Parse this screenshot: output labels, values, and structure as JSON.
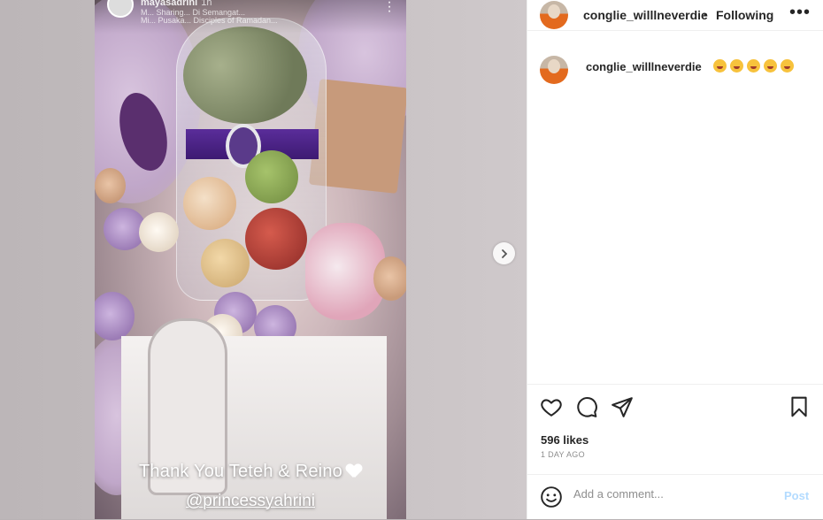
{
  "story": {
    "username": "mayasadrini",
    "time": "1h",
    "location_line1": "M... Sharing... Di Semangat...",
    "location_line2": "Mi... Pusaka... Disciples of Ramadan...",
    "caption_thanks": "Thank You Teteh & Reino",
    "caption_mention": "@princessyahrini"
  },
  "post": {
    "username": "conglie_willlneverdie",
    "separator": "•",
    "follow_status": "Following",
    "more_label": "•••",
    "comment_username": "conglie_willlneverdie",
    "comment_emojis": 5,
    "likes": "596 likes",
    "time": "1 DAY AGO",
    "comment_placeholder": "Add a comment...",
    "post_label": "Post"
  },
  "icons": {
    "like": "heart-icon",
    "comment": "comment-icon",
    "share": "share-icon",
    "save": "bookmark-icon",
    "emoji": "smile-icon",
    "next": "chevron-right-icon"
  },
  "colors": {
    "link_disabled": "#b3dbff",
    "text": "#262626",
    "muted": "#8e8e8e"
  }
}
